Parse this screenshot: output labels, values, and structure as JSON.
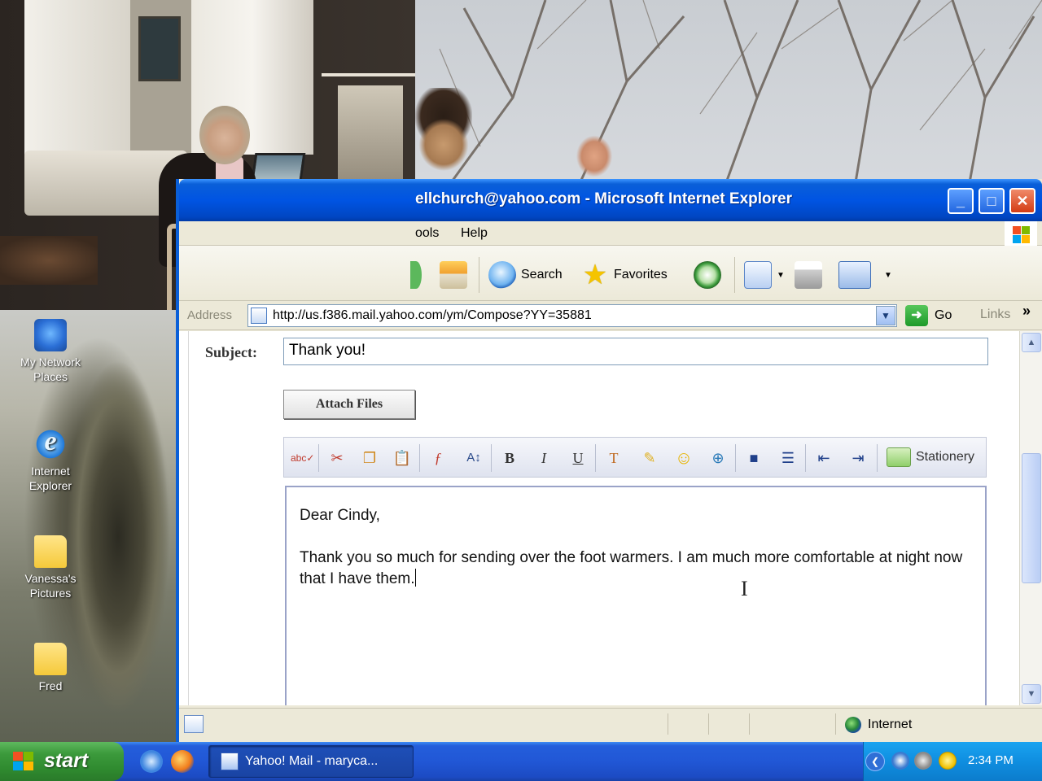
{
  "desktop": {
    "icons": [
      {
        "label": "My Network Places"
      },
      {
        "label": "Internet Explorer"
      },
      {
        "label": "Vanessa's Pictures"
      },
      {
        "label": "Fred"
      }
    ]
  },
  "window": {
    "title": "ellchurch@yahoo.com - Microsoft Internet Explorer",
    "menu": [
      "ools",
      "Help"
    ],
    "toolbar": {
      "search_label": "Search",
      "favorites_label": "Favorites"
    },
    "address": {
      "label": "Address",
      "url": "http://us.f386.mail.yahoo.com/ym/Compose?YY=35881",
      "go_label": "Go",
      "links_label": "Links",
      "chevron": "»"
    },
    "status": {
      "zone": "Internet"
    }
  },
  "compose": {
    "subject_label": "Subject:",
    "subject_value": "Thank you!",
    "attach_label": "Attach Files",
    "format_buttons": {
      "bold": "B",
      "italic": "I",
      "underline": "U"
    },
    "stationery_label": "Stationery",
    "body": {
      "greeting": "Dear Cindy,",
      "paragraph": "Thank you so much for sending over the foot warmers. I am much more comfortable at night now that I have them."
    }
  },
  "taskbar": {
    "start_label": "start",
    "task_label": "Yahoo! Mail - maryca...",
    "clock": "2:34 PM"
  },
  "colors": {
    "title_blue": "#0054e3",
    "start_green": "#3c9a3c",
    "tray_blue": "#0f8ee0"
  }
}
